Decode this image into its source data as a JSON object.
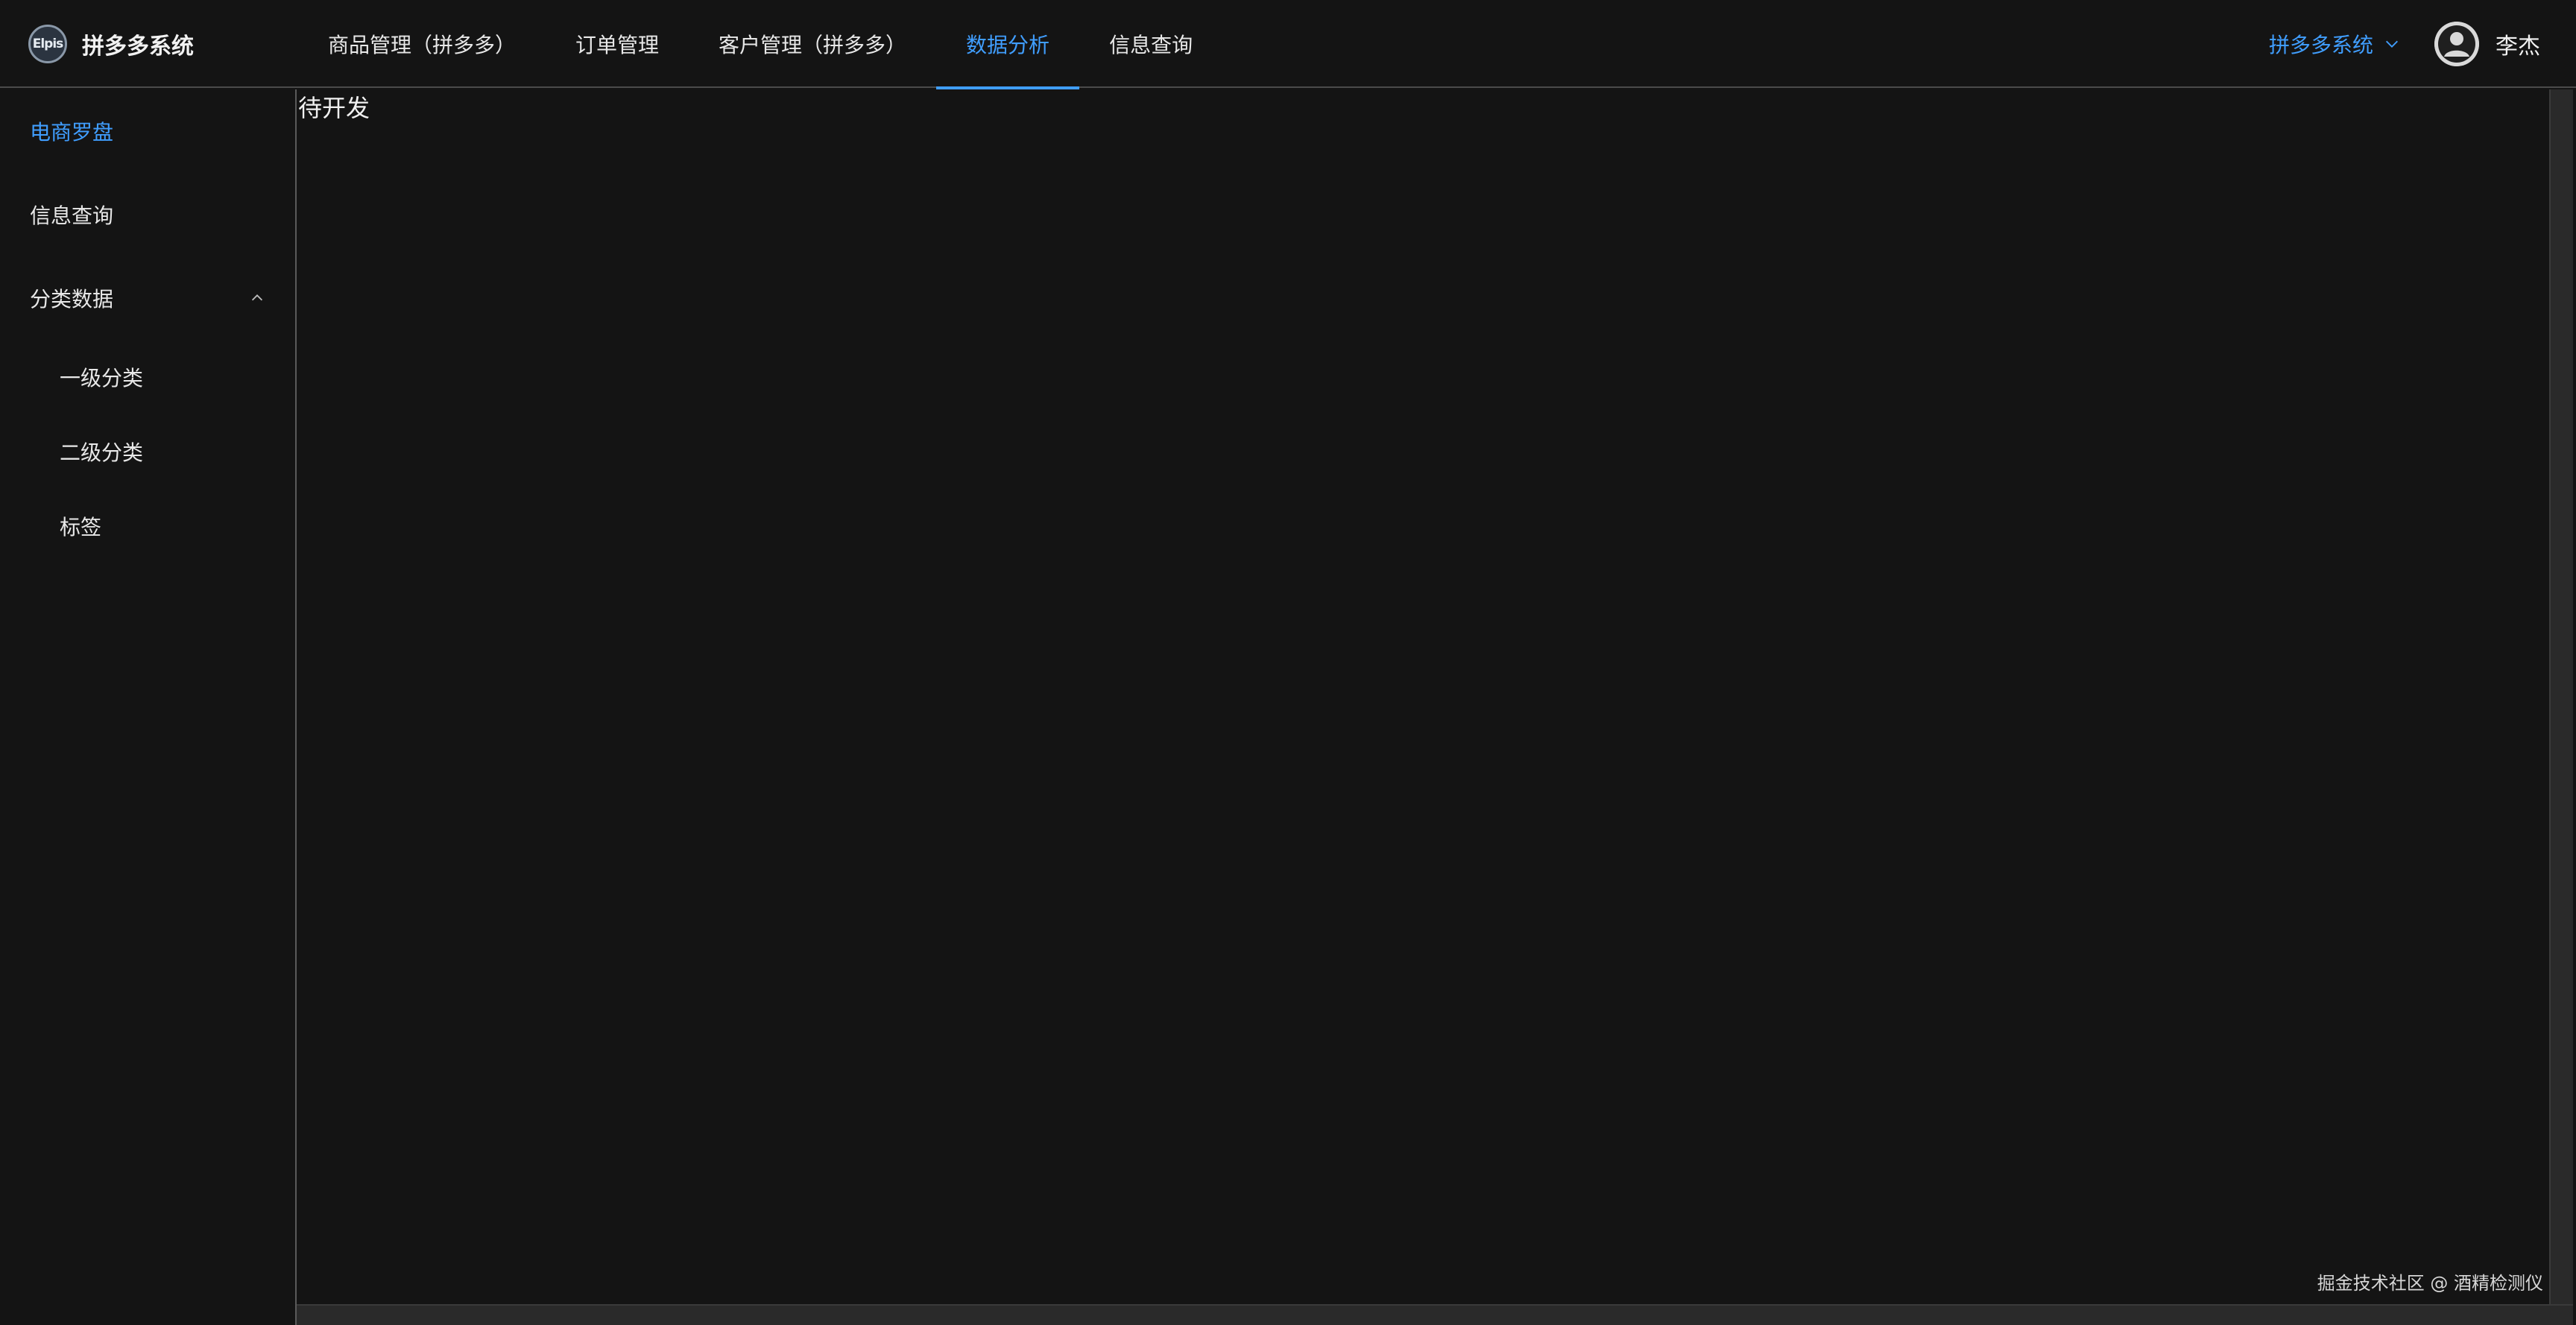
{
  "brand": {
    "logo_text": "Elpis",
    "title": "拼多多系统"
  },
  "topnav": {
    "items": [
      {
        "label": "商品管理（拼多多）",
        "active": false
      },
      {
        "label": "订单管理",
        "active": false
      },
      {
        "label": "客户管理（拼多多）",
        "active": false
      },
      {
        "label": "数据分析",
        "active": true
      },
      {
        "label": "信息查询",
        "active": false
      }
    ]
  },
  "header_right": {
    "system_switch": "拼多多系统",
    "system_switch_icon": "chevron-down-icon",
    "avatar_icon": "user-avatar-icon",
    "username": "李杰"
  },
  "sidebar": {
    "items": [
      {
        "label": "电商罗盘",
        "active": true
      },
      {
        "label": "信息查询",
        "active": false
      },
      {
        "label": "分类数据",
        "active": false,
        "expanded": true,
        "icon": "chevron-up-icon"
      }
    ],
    "subitems": [
      {
        "label": "一级分类"
      },
      {
        "label": "二级分类"
      },
      {
        "label": "标签"
      }
    ]
  },
  "main": {
    "placeholder_text": "待开发"
  },
  "watermark": "掘金技术社区 @ 酒精检测仪",
  "colors": {
    "accent": "#409eff",
    "background": "#141414",
    "text": "#e8e8e8"
  }
}
